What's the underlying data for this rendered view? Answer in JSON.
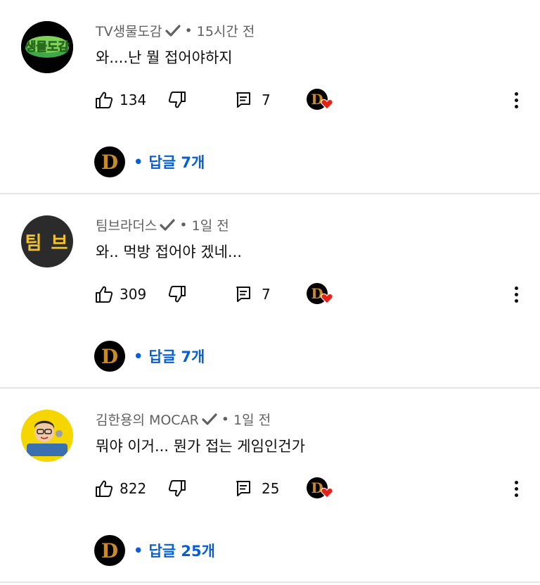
{
  "comments": [
    {
      "author": "TV생물도감",
      "time_sep": "•",
      "time": "15시간 전",
      "text": "와....난 뭘 접어야하지",
      "likes": "134",
      "reply_count": "7",
      "replies_label": "답글 7개",
      "avatar_text": "생물도감"
    },
    {
      "author": "팀브라더스",
      "time_sep": "•",
      "time": "1일 전",
      "text": "와.. 먹방 접어야 겠네...",
      "likes": "309",
      "reply_count": "7",
      "replies_label": "답글 7개",
      "avatar_text": "팀 브"
    },
    {
      "author": "김한용의 MOCAR",
      "time_sep": "•",
      "time": "1일 전",
      "text": "뭐야 이거... 뭔가 접는 게임인건가",
      "likes": "822",
      "reply_count": "25",
      "replies_label": "답글 25개",
      "avatar_text": ""
    }
  ],
  "creator_logo_letter": "D",
  "bullet": "•",
  "colors": {
    "link": "#065fd4",
    "meta": "#606060",
    "heart": "#e62117",
    "logo_gold": "#c98a2a"
  },
  "icons": [
    "thumbs-up-icon",
    "thumbs-down-icon",
    "reply-icon",
    "creator-heart-icon",
    "more-vert-icon",
    "verified-check-icon"
  ]
}
